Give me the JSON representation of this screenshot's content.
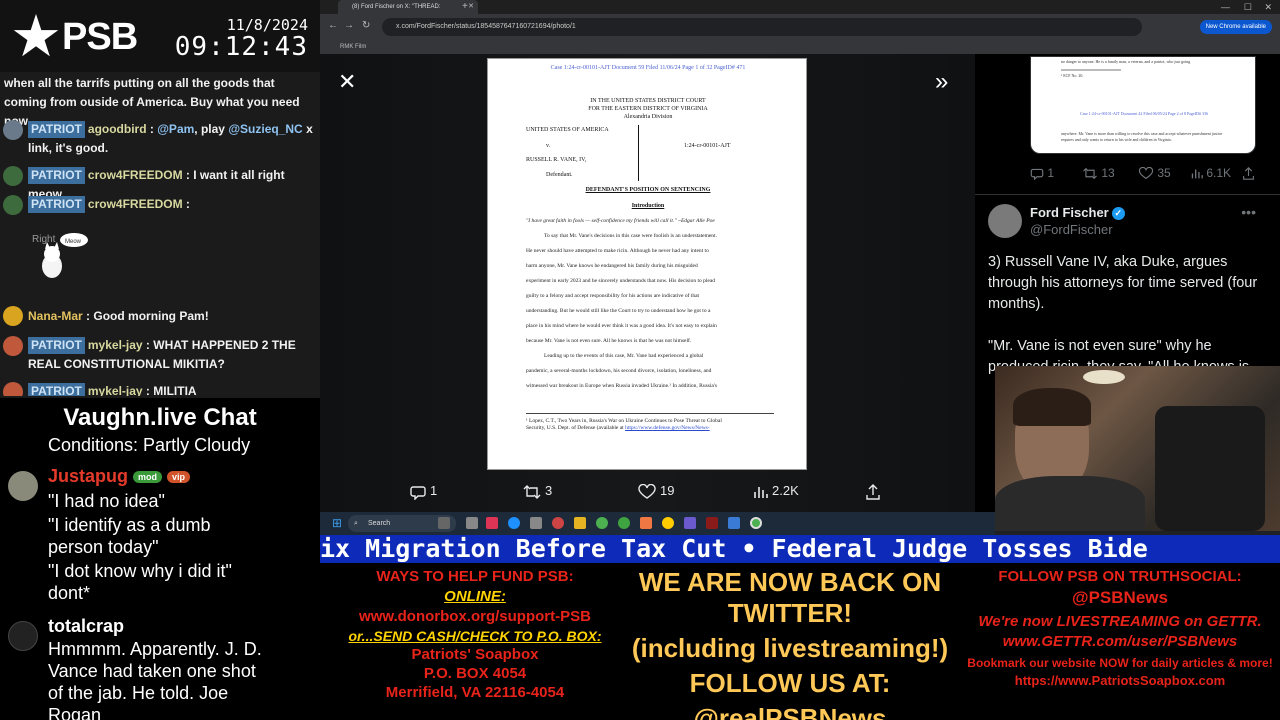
{
  "overlay": {
    "logo_text": "PSB",
    "date": "11/8/2024",
    "time": "09:12:43"
  },
  "psb_chat": {
    "messages": [
      {
        "text": "when all the tarrifs putting on all the goods that coming from ouside of America. Buy what you need now."
      },
      {
        "badge": "PATRIOT",
        "user": "agoodbird",
        "mention1": "@Pam",
        "mid": ", play",
        "mention2": "@Suzieq_NC",
        "text": "x link, it's good."
      },
      {
        "badge": "PATRIOT",
        "user": "crow4FREEDOM",
        "text": "I want it all right meow"
      },
      {
        "badge": "PATRIOT",
        "user": "crow4FREEDOM",
        "text": ""
      },
      {
        "user": "Nana-Mar",
        "text": "Good morning Pam!"
      },
      {
        "badge": "PATRIOT",
        "user": "mykel-jay",
        "text": "WHAT HAPPENED 2 THE REAL CONSTITUTIONAL MIKITIA?"
      },
      {
        "badge": "PATRIOT",
        "user": "mykel-jay",
        "text": "MILITIA"
      }
    ],
    "emote_label": "Right",
    "emote_bubble": "Meow"
  },
  "vaughn_chat": {
    "title": "Vaughn.live Chat",
    "lines": [
      "Conditions: Partly Cloudy",
      "\"I had no idea\"",
      "\"I identify as a dumb",
      "person today\"",
      "\"I dot know why i did it\"",
      "dont*",
      "Hmmmm. Apparently. J. D.",
      "Vance had taken one shot",
      "of the jab. He told. Joe",
      "Rogan"
    ],
    "user1": "Justapug",
    "user1_badges": [
      "mod",
      "vip"
    ],
    "user2": "totalcrap"
  },
  "browser": {
    "tab_title": "(8) Ford Fischer on X: \"THREAD:",
    "url": "x.com/FordFischer/status/1854587647160721694/photo/1",
    "bookmark": "RMK Film",
    "new_chrome": "New Chrome available",
    "viewer": {
      "doc_header": "Case 1:24-cr-00101-AJT   Document 59   Filed 11/06/24   Page 1 of 32 PageID# 471",
      "court_lines": [
        "IN THE UNITED STATES DISTRICT COURT",
        "FOR THE EASTERN DISTRICT OF VIRGINIA",
        "Alexandria Division"
      ],
      "plaintiff": "UNITED STATES OF AMERICA",
      "v": "v.",
      "case_no": "1:24-cr-00101-AJT",
      "defendant_name": "RUSSELL R. VANE, IV,",
      "defendant_label": "Defendant.",
      "doc_title": "DEFENDANT'S POSITION ON SENTENCING",
      "section": "Introduction",
      "quote": "\"I have great faith in fools — self-confidence my friends will call it.\" ~Edgar Alle Poe",
      "paragraphs": [
        "To say that Mr. Vane's decisions in this case were foolish is an understatement.",
        "He never should have attempted to make ricin. Although he never had any intent to",
        "harm anyone, Mr. Vane knows he endangered his family during his misguided",
        "experiment in early 2023 and he sincerely understands that now. His decision to plead",
        "guilty to a felony and accept responsibility for his actions are indicative of that",
        "understanding. But he would still like the Court to try to understand how he got to a",
        "place in his mind where he would ever think it was a good idea. It's not easy to explain",
        "because Mr. Vane is not even sure. All he knows is that he was not himself.",
        "Leading up to the events of this case, Mr. Vane had experienced a global",
        "pandemic, a several-months lockdown, his second divorce, isolation, loneliness, and",
        "witnessed war breakout in Europe when Russia invaded Ukraine.¹ In addition, Russia's"
      ],
      "footnote1": "¹ Lopez, C.T., Two Years in, Russia's War on Ukraine Continues to Pose Threat to Global",
      "footnote2": "Security, U.S. Dept. of Defense (available at",
      "footnote_link": "https://www.defense.gov/News/News-"
    },
    "viewer_actions": {
      "replies": "1",
      "reposts": "3",
      "likes": "19",
      "views": "2.2K"
    },
    "right_pane": {
      "embed_top_text": "no danger to anyone. He is a family man, a veteran, and a patriot, who just going",
      "embed_ecf": "¹ ECF No. 20.",
      "embed_footer": "Case 1:24-cr-00101-AJT   Document 42   Filed 06/05/24   Page 2 of 8 PageID# 336",
      "embed_bottom_text": "anywhere. Mr. Vane is more than willing to resolve this case and accept whatever punishment justice requires and only wants to return to his wife and children in Virginia.",
      "actions": {
        "replies": "1",
        "reposts": "13",
        "likes": "35",
        "views": "6.1K"
      },
      "author_name": "Ford Fischer",
      "author_handle": "@FordFischer",
      "tweet_text": "3) Russell Vane IV, aka Duke, argues through his attorneys for time served (four months).",
      "tweet_text2": "\"Mr. Vane is not even sure\" why he produced ricin, they say. \"All he knows is"
    }
  },
  "taskbar": {
    "search_label": "Search"
  },
  "ticker": {
    "text": "ix Migration Before Tax Cut   •   Federal Judge Tosses Bide"
  },
  "bottom_banner": {
    "left": {
      "heading": "WAYS TO HELP FUND PSB:",
      "online": "ONLINE:",
      "donor_url": "www.donorbox.org/support-PSB",
      "or_send": "or...SEND CASH/CHECK TO P.O. BOX:",
      "addr1": "Patriots' Soapbox",
      "addr2": "P.O. BOX 4054",
      "addr3": "Merrifield, VA 22116-4054"
    },
    "middle": {
      "line1": "WE ARE NOW BACK ON TWITTER!",
      "line2": "(including livestreaming!)",
      "line3": "FOLLOW US AT:",
      "line4": "@realPSBNews"
    },
    "right": {
      "heading": "FOLLOW PSB ON TRUTHSOCIAL:",
      "handle": "@PSBNews",
      "gettr1": "We're now LIVESTREAMING on GETTR.",
      "gettr2": "www.GETTR.com/user/PSBNews",
      "bookmark": "Bookmark our website NOW for daily articles & more!",
      "site": "https://www.PatriotsSoapbox.com"
    }
  },
  "colors": {
    "ticker_bg": "#0d2ab8",
    "badge_bg": "#3c6f9e",
    "red": "#e8231a",
    "yellow": "#ffd400"
  }
}
